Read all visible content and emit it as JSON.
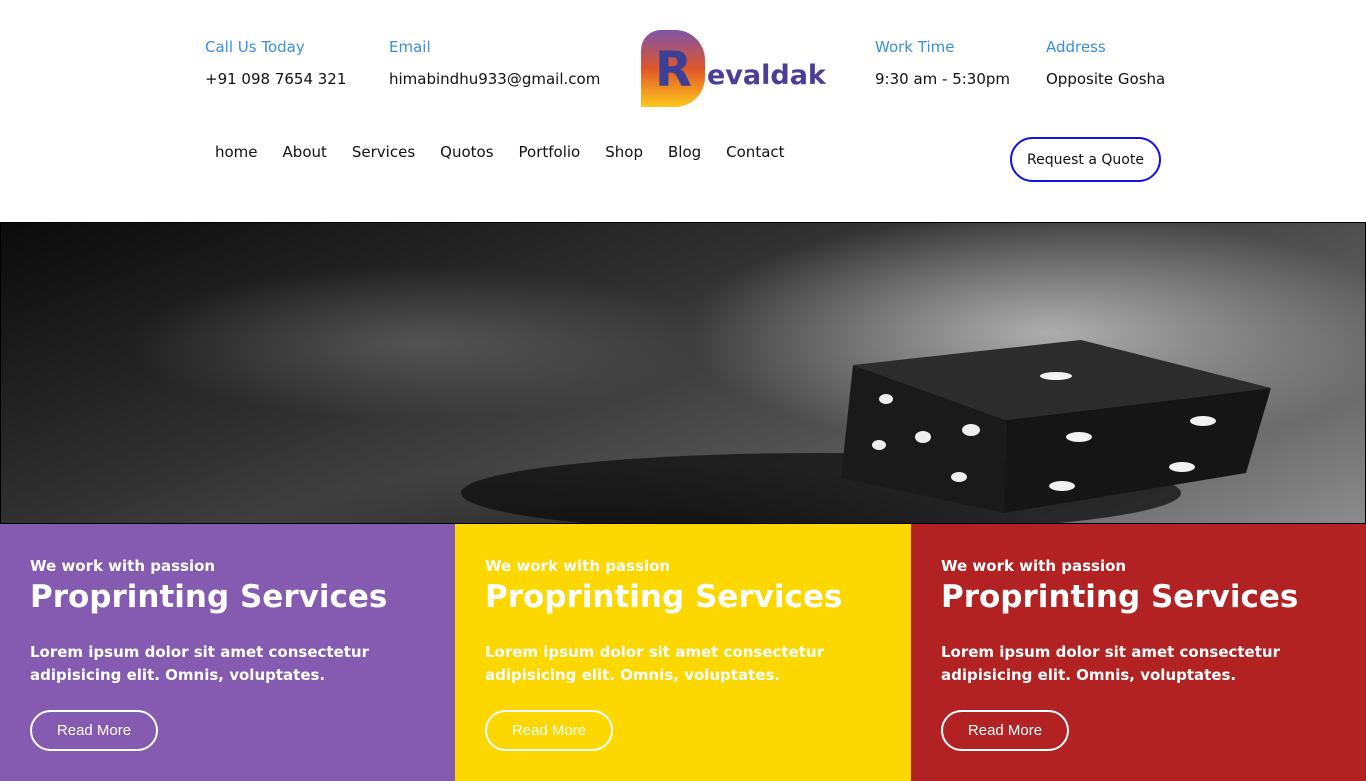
{
  "header": {
    "contacts": [
      {
        "label": "Call Us Today",
        "value": "+91 098 7654 321"
      },
      {
        "label": "Email",
        "value": "himabindhu933@gmail.com"
      },
      {
        "label": "Work Time",
        "value": "9:30 am - 5:30pm"
      },
      {
        "label": "Address",
        "value": "Opposite Gosha"
      }
    ],
    "logo": {
      "initial": "R",
      "rest": "evaldak"
    }
  },
  "nav": {
    "items": [
      "home",
      "About",
      "Services",
      "Quotos",
      "Portfolio",
      "Shop",
      "Blog",
      "Contact"
    ],
    "quote_button": "Request a Quote"
  },
  "hero": {
    "image": "dice-on-smoky-background"
  },
  "cards": [
    {
      "kicker": "We work with passion",
      "title": "Proprinting Services",
      "text": "Lorem ipsum dolor sit amet consectetur adipisicing elit. Omnis, voluptates.",
      "button": "Read More",
      "color": "#845bb0"
    },
    {
      "kicker": "We work with passion",
      "title": "Proprinting Services",
      "text": "Lorem ipsum dolor sit amet consectetur adipisicing elit. Omnis, voluptates.",
      "button": "Read More",
      "color": "#fdd800"
    },
    {
      "kicker": "We work with passion",
      "title": "Proprinting Services",
      "text": "Lorem ipsum dolor sit amet consectetur adipisicing elit. Omnis, voluptates.",
      "button": "Read More",
      "color": "#b22222"
    }
  ],
  "colors": {
    "label_blue": "#3b8ee0",
    "button_border": "#1414e0"
  }
}
